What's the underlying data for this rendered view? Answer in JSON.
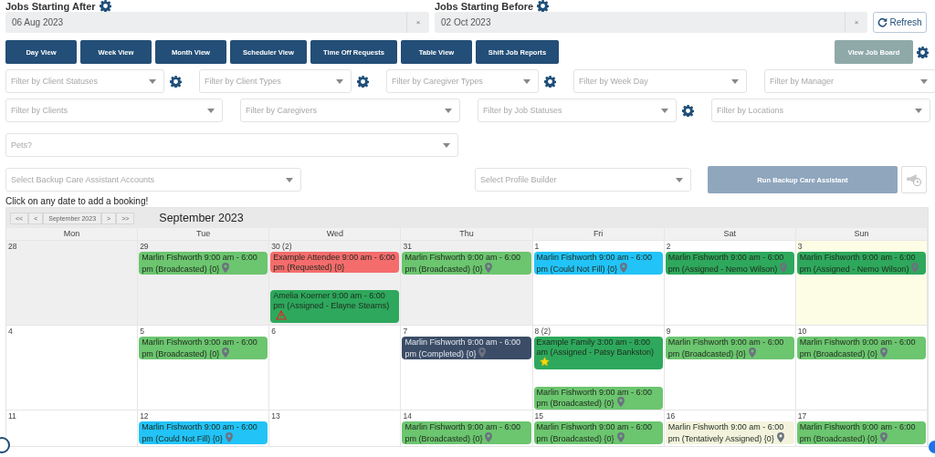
{
  "date_filters": [
    {
      "label": "Jobs Starting After",
      "value": "06 Aug 2023"
    },
    {
      "label": "Jobs Starting Before",
      "value": "02 Oct 2023"
    }
  ],
  "clear_glyph": "×",
  "refresh_button": "Refresh",
  "view_buttons": [
    "Day View",
    "Week View",
    "Month View",
    "Scheduler View",
    "Time Off Requests",
    "Table View",
    "Shift Job Reports"
  ],
  "job_board_button": {
    "label": "View Job Board",
    "disabled": true
  },
  "filter_rows": [
    [
      {
        "placeholder": "Filter by Client Statuses",
        "has_settings": true
      },
      {
        "placeholder": "Filter by Client Types",
        "has_settings": true
      },
      {
        "placeholder": "Filter by Caregiver Types",
        "has_settings": true
      },
      {
        "placeholder": "Filter by Week Day",
        "has_settings": false
      },
      {
        "placeholder": "Filter by Manager",
        "has_settings": false
      }
    ],
    [
      {
        "placeholder": "Filter by Clients",
        "has_settings": false
      },
      {
        "placeholder": "Filter by Caregivers",
        "has_settings": false
      },
      {
        "placeholder": "Filter by Job Statuses",
        "has_settings": true
      },
      {
        "placeholder": "Filter by Locations",
        "has_settings": false
      }
    ],
    [
      {
        "placeholder": "Pets?",
        "has_settings": false
      }
    ]
  ],
  "backup": {
    "accounts_placeholder": "Select Backup Care Assistant Accounts",
    "profile_placeholder": "Select Profile Builder",
    "run_button": {
      "label": "Run Backup Care Assistant",
      "disabled": true
    }
  },
  "hint": "Click on any date to add a booking!",
  "calendar": {
    "nav": [
      "<<",
      "<",
      "September 2023",
      ">",
      ">>"
    ],
    "title": "September 2023",
    "weekdays": [
      "Mon",
      "Tue",
      "Wed",
      "Thu",
      "Fri",
      "Sat",
      "Sun"
    ],
    "weeks": [
      [
        {
          "date": "28",
          "other_month": true,
          "today": false
        },
        {
          "date": "29",
          "other_month": true,
          "today": false,
          "events": [
            {
              "text": "Marlin Fishworth 9:00 am - 6:00 pm (Broadcasted) {0}",
              "color": "#6cc56f",
              "kind": "pin"
            }
          ]
        },
        {
          "date": "30 (2)",
          "other_month": true,
          "today": false,
          "events": [
            {
              "text": "Example Attendee 9:00 am - 6:00 pm (Requested) {0}",
              "color": "#f56c6c",
              "kind": "plain"
            },
            {
              "text": "Amelia Koerner 9:00 am - 6:00 pm (Assigned - Elayne Stearns)",
              "color": "#2ea85c",
              "kind": "warning"
            }
          ]
        },
        {
          "date": "31",
          "other_month": true,
          "today": false,
          "events": [
            {
              "text": "Marlin Fishworth 9:00 am - 6:00 pm (Broadcasted) {0}",
              "color": "#6cc56f",
              "kind": "pin"
            }
          ]
        },
        {
          "date": "1",
          "other_month": false,
          "today": false,
          "events": [
            {
              "text": "Marlin Fishworth 9:00 am - 6:00 pm (Could Not Fill) {0}",
              "color": "#22c3f7",
              "kind": "pin"
            }
          ]
        },
        {
          "date": "2",
          "other_month": false,
          "today": false,
          "events": [
            {
              "text": "Marlin Fishworth 9:00 am - 6:00 pm (Assigned - Nemo Wilson)",
              "color": "#2ea85c",
              "kind": "pin"
            }
          ]
        },
        {
          "date": "3",
          "other_month": false,
          "today": true,
          "events": [
            {
              "text": "Marlin Fishworth 9:00 am - 6:00 pm (Assigned - Nemo Wilson)",
              "color": "#2ea85c",
              "kind": "pin"
            }
          ]
        }
      ],
      [
        {
          "date": "4",
          "other_month": false,
          "today": false
        },
        {
          "date": "5",
          "other_month": false,
          "today": false,
          "events": [
            {
              "text": "Marlin Fishworth 9:00 am - 6:00 pm (Broadcasted) {0}",
              "color": "#6cc56f",
              "kind": "pin"
            }
          ]
        },
        {
          "date": "6",
          "other_month": false,
          "today": false
        },
        {
          "date": "7",
          "other_month": false,
          "today": false,
          "events": [
            {
              "text": "Marlin Fishworth 9:00 am - 6:00 pm (Completed) {0}",
              "color": "#3b4c66",
              "kind": "pin"
            }
          ]
        },
        {
          "date": "8 (2)",
          "other_month": false,
          "today": false,
          "events": [
            {
              "text": "Example Family 3:00 am - 8:00 am (Assigned - Patsy Bankston)",
              "color": "#2ea85c",
              "kind": "star"
            },
            {
              "text": "Marlin Fishworth 9:00 am - 6:00 pm (Broadcasted) {0}",
              "color": "#6cc56f",
              "kind": "pin"
            }
          ]
        },
        {
          "date": "9",
          "other_month": false,
          "today": false,
          "events": [
            {
              "text": "Marlin Fishworth 9:00 am - 6:00 pm (Broadcasted) {0}",
              "color": "#6cc56f",
              "kind": "pin"
            }
          ]
        },
        {
          "date": "10",
          "other_month": false,
          "today": false,
          "events": [
            {
              "text": "Marlin Fishworth 9:00 am - 6:00 pm (Broadcasted) {0}",
              "color": "#6cc56f",
              "kind": "pin"
            }
          ]
        }
      ],
      [
        {
          "date": "11",
          "other_month": false,
          "today": false
        },
        {
          "date": "12",
          "other_month": false,
          "today": false,
          "events": [
            {
              "text": "Marlin Fishworth 9:00 am - 6:00 pm (Could Not Fill) {0}",
              "color": "#22c3f7",
              "kind": "pin"
            }
          ]
        },
        {
          "date": "13",
          "other_month": false,
          "today": false
        },
        {
          "date": "14",
          "other_month": false,
          "today": false,
          "events": [
            {
              "text": "Marlin Fishworth 9:00 am - 6:00 pm (Broadcasted) {0}",
              "color": "#6cc56f",
              "kind": "pin"
            }
          ]
        },
        {
          "date": "15",
          "other_month": false,
          "today": false,
          "events": [
            {
              "text": "Marlin Fishworth 9:00 am - 6:00 pm (Broadcasted) {0}",
              "color": "#6cc56f",
              "kind": "pin"
            }
          ]
        },
        {
          "date": "16",
          "other_month": false,
          "today": false,
          "events": [
            {
              "text": "Marlin Fishworth 9:00 am - 6:00 pm (Tentatively Assigned) {0}",
              "color": "#f3f3dd",
              "kind": "pin"
            }
          ]
        },
        {
          "date": "17",
          "other_month": false,
          "today": false,
          "events": [
            {
              "text": "Marlin Fishworth 9:00 am - 6:00 pm (Broadcasted) {0}",
              "color": "#6cc56f",
              "kind": "pin"
            }
          ]
        }
      ]
    ]
  }
}
